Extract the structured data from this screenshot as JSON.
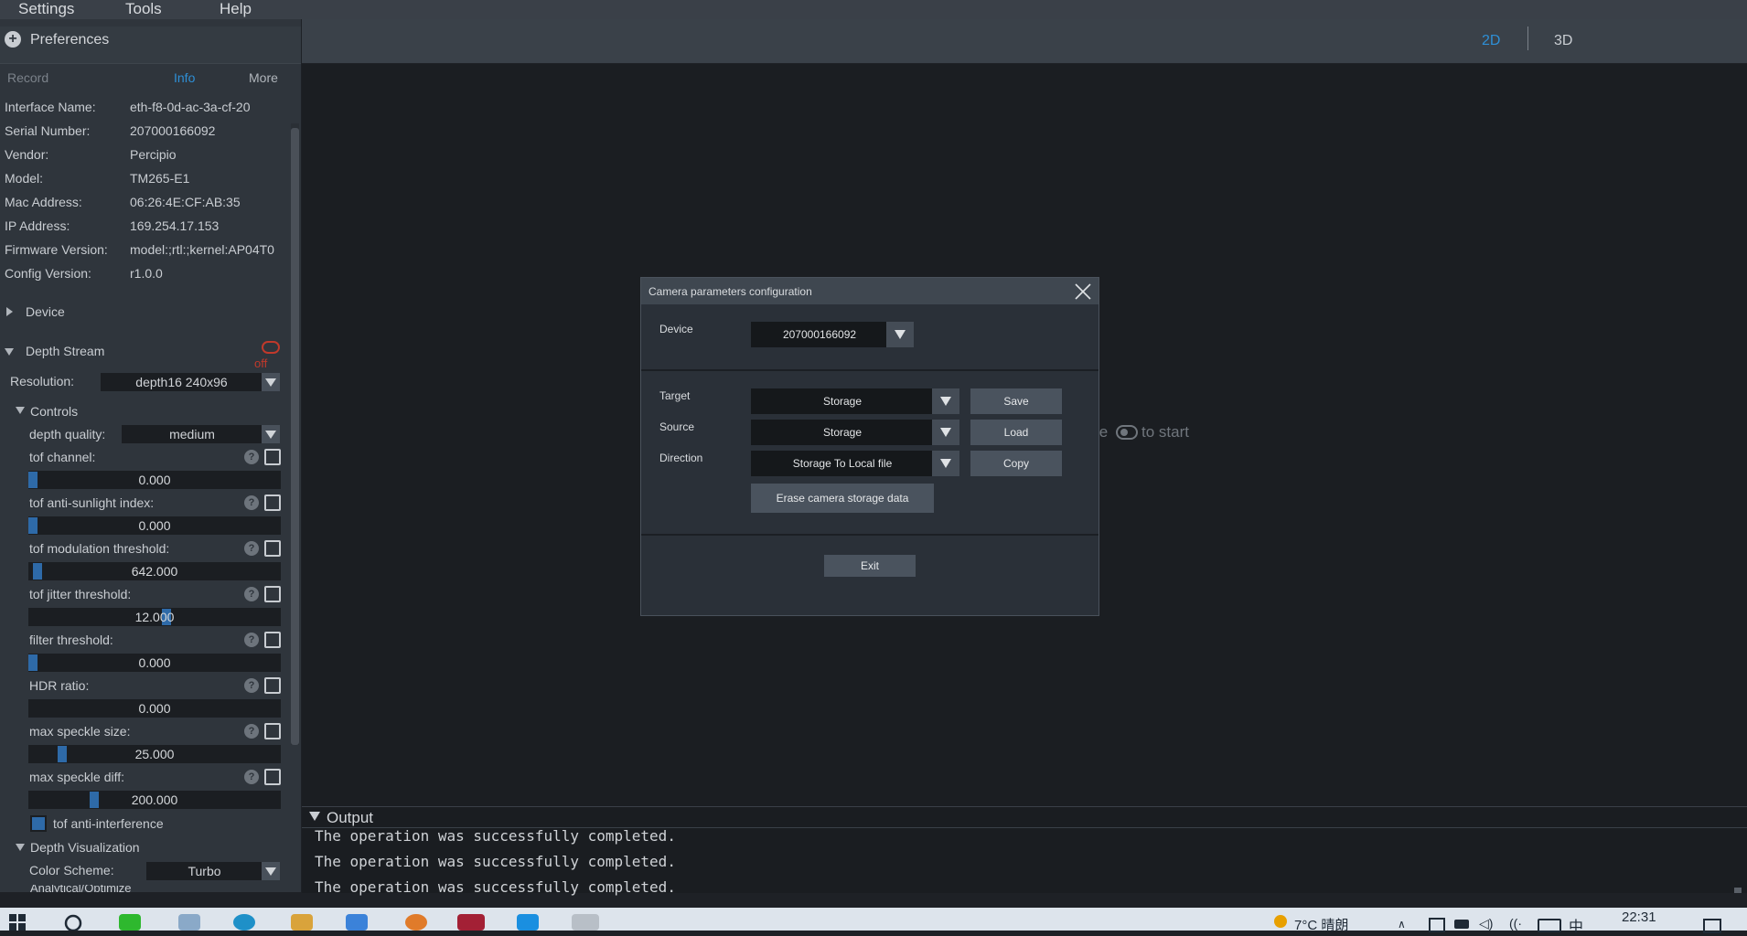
{
  "menu": [
    "Settings",
    "Tools",
    "Help"
  ],
  "preferences": {
    "title": "Preferences"
  },
  "info_tabs": [
    "Record",
    "Info",
    "More"
  ],
  "info": [
    {
      "label": "Interface Name:",
      "value": "eth-f8-0d-ac-3a-cf-20"
    },
    {
      "label": "Serial Number:",
      "value": "207000166092"
    },
    {
      "label": "Vendor:",
      "value": "Percipio"
    },
    {
      "label": "Model:",
      "value": "TM265-E1"
    },
    {
      "label": "Mac Address:",
      "value": "06:26:4E:CF:AB:35"
    },
    {
      "label": "IP Address:",
      "value": "169.254.17.153"
    },
    {
      "label": "Firmware Version:",
      "value": "model:;rtl:;kernel:AP04T0"
    },
    {
      "label": "Config Version:",
      "value": "r1.0.0"
    }
  ],
  "device_section": "Device",
  "depth_stream": {
    "title": "Depth Stream",
    "state": "off",
    "resolution_label": "Resolution:",
    "resolution": "depth16 240x96",
    "controls_label": "Controls",
    "depth_quality_label": "depth quality:",
    "depth_quality": "medium",
    "controls": [
      {
        "label": "tof channel:",
        "value": "0.000",
        "level": 0.0
      },
      {
        "label": "tof anti-sunlight index:",
        "value": "0.000",
        "level": 0.0
      },
      {
        "label": "tof modulation threshold:",
        "value": "642.000",
        "level": 0.02
      },
      {
        "label": "tof jitter threshold:",
        "value": "12.000",
        "level": 0.55
      },
      {
        "label": "filter threshold:",
        "value": "0.000",
        "level": 0.0
      },
      {
        "label": "HDR ratio:",
        "value": "0.000",
        "level": null
      },
      {
        "label": "max speckle size:",
        "value": "25.000",
        "level": 0.12
      },
      {
        "label": "max speckle diff:",
        "value": "200.000",
        "level": 0.25
      }
    ],
    "anti_interference_label": "tof anti-interference",
    "visualization_label": "Depth Visualization",
    "color_scheme_label": "Color Scheme:",
    "color_scheme": "Turbo",
    "next_section": "Analytical/Optimize"
  },
  "view_tabs": [
    "2D",
    "3D"
  ],
  "viewport_hint": {
    "prefix": "le",
    "suffix": "to start"
  },
  "dialog": {
    "title": "Camera parameters configuration",
    "device_label": "Device",
    "device_value": "207000166092",
    "target_label": "Target",
    "target_value": "Storage",
    "source_label": "Source",
    "source_value": "Storage",
    "direction_label": "Direction",
    "direction_value": "Storage To Local file",
    "save": "Save",
    "load": "Load",
    "copy": "Copy",
    "erase": "Erase camera storage data",
    "exit": "Exit"
  },
  "output": {
    "title": "Output",
    "lines": [
      "The operation was successfully completed.",
      "The operation was successfully completed.",
      "The operation was successfully completed."
    ]
  },
  "taskbar": {
    "weather": "7°C 晴朗",
    "time": "22:31",
    "ime": "中"
  },
  "colors": {
    "accent": "#2e8fd6",
    "stream_off": "#c0392b"
  }
}
